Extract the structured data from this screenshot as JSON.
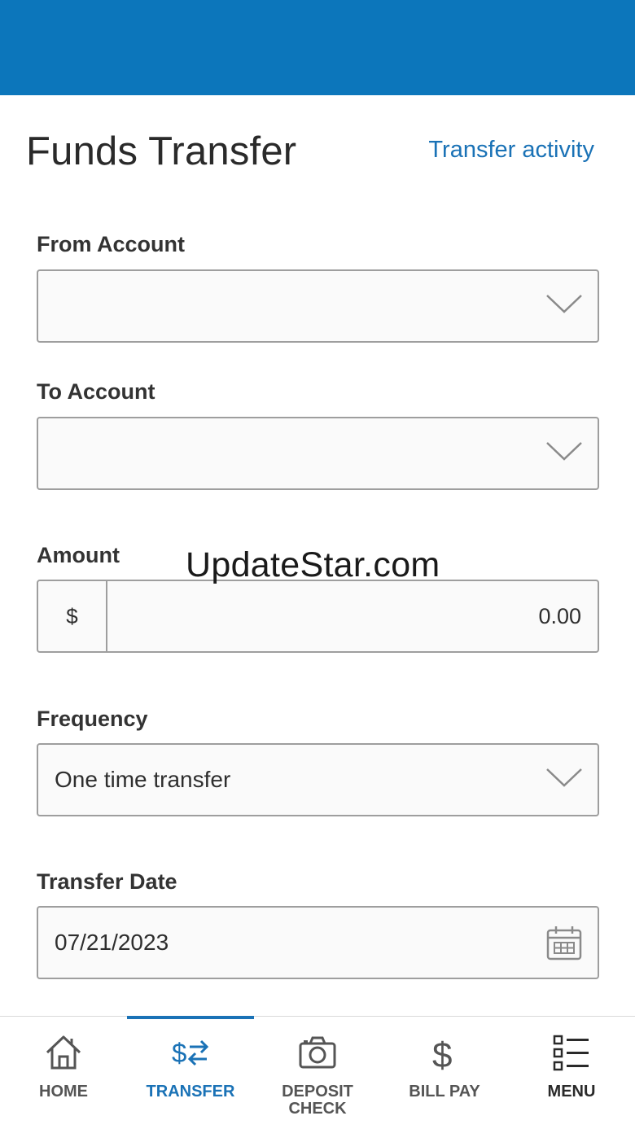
{
  "header": {
    "title": "Funds Transfer",
    "activity_link": "Transfer activity"
  },
  "form": {
    "from_account": {
      "label": "From Account",
      "value": ""
    },
    "to_account": {
      "label": "To Account",
      "value": ""
    },
    "amount": {
      "label": "Amount",
      "currency": "$",
      "value": "0.00"
    },
    "frequency": {
      "label": "Frequency",
      "value": "One time transfer"
    },
    "transfer_date": {
      "label": "Transfer Date",
      "value": "07/21/2023"
    }
  },
  "watermark": "UpdateStar.com",
  "nav": {
    "home": "HOME",
    "transfer": "TRANSFER",
    "deposit_line1": "DEPOSIT",
    "deposit_line2": "CHECK",
    "bill_pay": "BILL PAY",
    "menu": "MENU",
    "active": "transfer"
  },
  "colors": {
    "brand": "#0c76bb",
    "accent": "#1a72b6",
    "border": "#9e9e9e"
  },
  "icons": [
    "chevron-down-icon",
    "calendar-icon",
    "home-icon",
    "transfer-icon",
    "camera-icon",
    "dollar-icon",
    "menu-icon"
  ]
}
